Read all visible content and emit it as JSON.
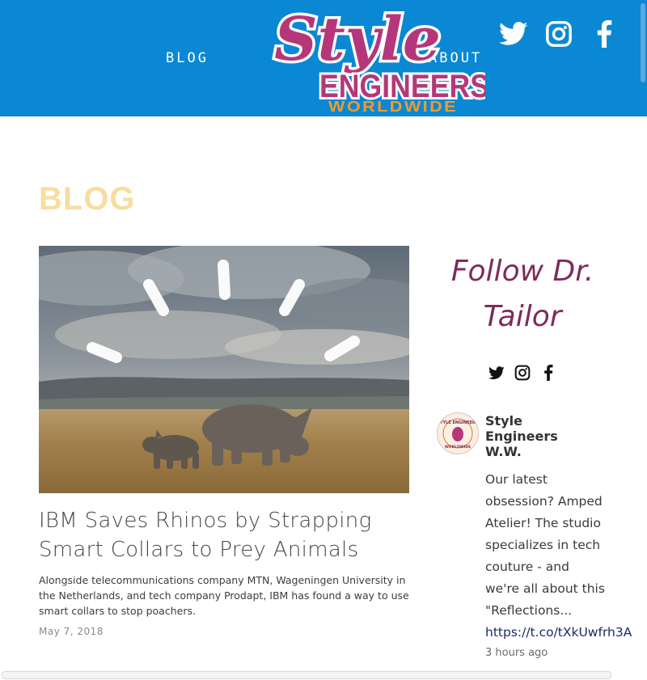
{
  "header": {
    "nav": {
      "blog_label": "BLOG",
      "about_label": "ABOUT"
    },
    "logo": {
      "line1": "Style",
      "line2": "ENGINEERS",
      "line3": "WORLDWIDE"
    },
    "social": [
      "twitter-icon",
      "instagram-icon",
      "facebook-icon"
    ],
    "colors": {
      "bar": "#0a88d4",
      "logo_script": "#b5377a",
      "logo_accent": "#f39a2b"
    }
  },
  "main": {
    "page_heading": "BLOG",
    "post": {
      "title_line1": "IBM Saves Rhinos by Strapping",
      "title_line2": "Smart Collars to Prey Animals",
      "excerpt": "Alongside telecommunications company MTN, Wageningen University in the Netherlands, and tech company Prodapt, IBM has found a way to use smart collars to stop poachers.",
      "date": "May 7, 2018"
    }
  },
  "sidebar": {
    "follow_line1": "Follow Dr.",
    "follow_line2": "Tailor",
    "social": [
      "twitter-icon",
      "instagram-icon",
      "facebook-icon"
    ],
    "tweet": {
      "author_line1": "Style",
      "author_line2": "Engineers",
      "author_line3": "W.W.",
      "text_lines": [
        "Our latest",
        "obsession? Amped",
        "Atelier! The studio",
        "specializes in tech",
        "couture - and",
        "we're all about this",
        "\"Reflections..."
      ],
      "link": "https://t.co/tXkUwfrh3A",
      "time": "3 hours ago",
      "avatar_text_top": "STYLE ENGINEERS",
      "avatar_text_bottom": "WORLDWIDE"
    }
  }
}
